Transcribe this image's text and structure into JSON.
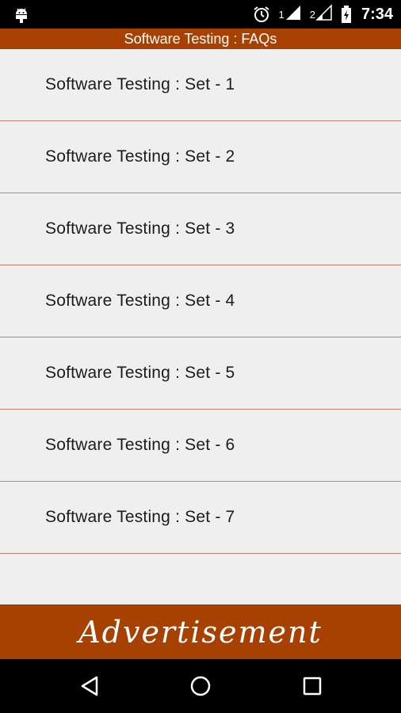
{
  "status_bar": {
    "sim1_label": "1",
    "sim2_label": "2",
    "time": "7:34",
    "icons": [
      "android-icon",
      "alarm-icon",
      "signal-icon",
      "signal-icon",
      "battery-charging-icon"
    ]
  },
  "app": {
    "title": "Software Testing : FAQs"
  },
  "list": {
    "items": [
      {
        "label": "Software Testing : Set - 1"
      },
      {
        "label": "Software Testing : Set - 2"
      },
      {
        "label": "Software Testing : Set - 3"
      },
      {
        "label": "Software Testing : Set - 4"
      },
      {
        "label": "Software Testing : Set - 5"
      },
      {
        "label": "Software Testing : Set - 6"
      },
      {
        "label": "Software Testing : Set - 7"
      }
    ]
  },
  "ad": {
    "label": "Advertisement"
  },
  "nav_bar": {
    "buttons": [
      "back-icon",
      "home-icon",
      "recents-icon"
    ]
  },
  "colors": {
    "title_bar": "#a84000",
    "ad_banner": "#a84000",
    "divider": "#c97e72",
    "background": "#efefef"
  }
}
